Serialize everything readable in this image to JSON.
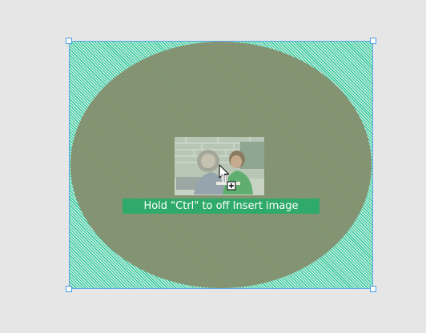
{
  "canvas": {
    "frame_border_color": "#5aa8e8",
    "pattern_primary_color": "#2ec99a",
    "ellipse_color": "#82936f"
  },
  "drop_preview": {
    "thumbnail_icon": "image-thumbnail-icon",
    "hint_text": "Hold \"Ctrl\" to off Insert image",
    "hint_background": "#2faa6a"
  },
  "cursor": {
    "icon": "arrow-copy-cursor-icon"
  }
}
